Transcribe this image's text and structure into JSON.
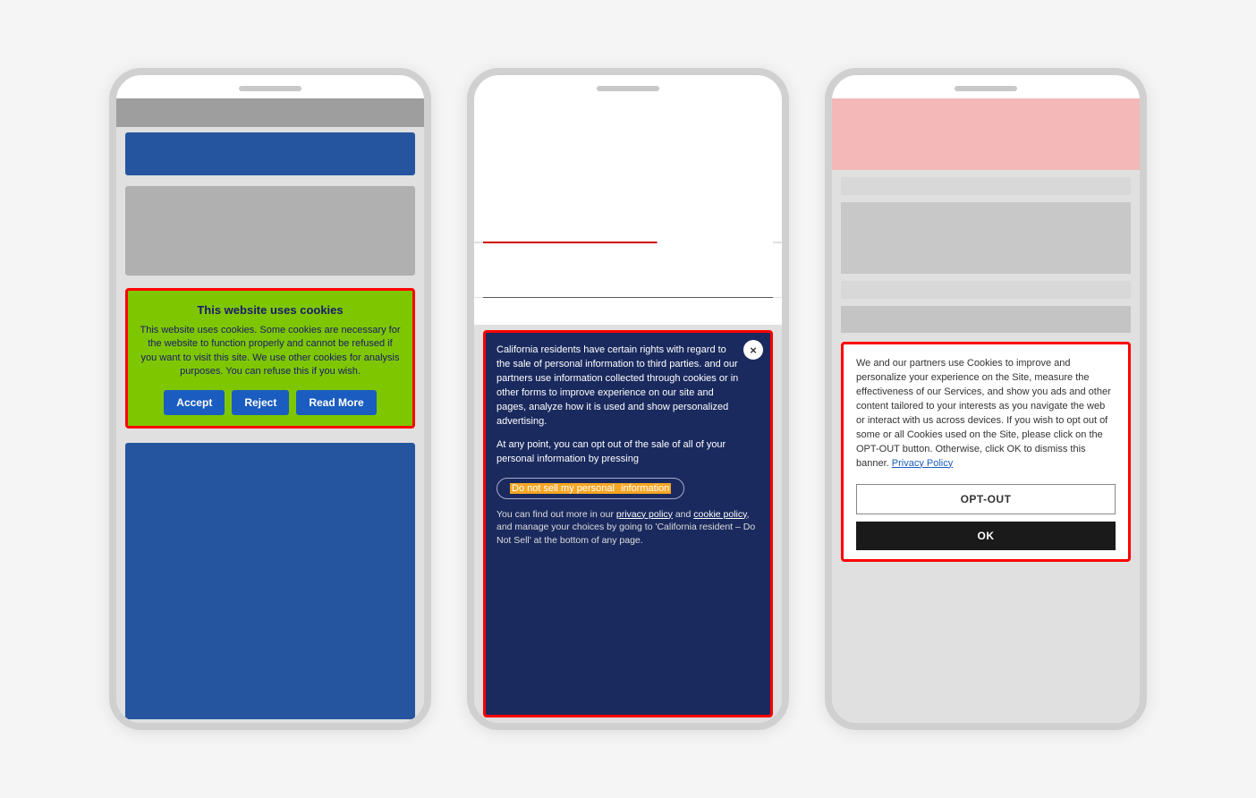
{
  "phone1": {
    "banner": {
      "title": "This website uses cookies",
      "body": "This website uses cookies. Some cookies are necessary for the website to function properly and cannot be refused if you want to visit this site. We use other cookies for analysis purposes. You can refuse this if you wish.",
      "accept_label": "Accept",
      "reject_label": "Reject",
      "read_more_label": "Read More"
    }
  },
  "phone2": {
    "banner": {
      "body1": "California residents have certain rights with regard to the sale of personal information to third parties.",
      "body2": "and our partners use information collected through cookies or in other forms to improve experience on our site and pages, analyze how it is used and show personalized advertising.",
      "opt_out_part1": "Do not sell my personal ",
      "opt_out_highlighted": "information",
      "body3": "At any point, you can opt out of the sale of all of your personal information by pressing",
      "footer": "You can find out more in our ",
      "privacy_link": "privacy policy",
      "and_text": " and ",
      "cookie_link": "cookie policy",
      "footer2": ", and manage your choices by going to 'California resident – Do Not Sell' at the bottom of any page.",
      "close_label": "×"
    }
  },
  "phone3": {
    "banner": {
      "body": "We and our partners use Cookies to improve and personalize your experience on the Site, measure the effectiveness of our Services, and show you ads and other content tailored to your interests as you navigate the web or interact with us across devices. If you wish to opt out of some or all Cookies used on the Site, please click on the OPT-OUT button. Otherwise, click OK to dismiss this banner.",
      "privacy_link": "Privacy Policy",
      "opt_out_label": "OPT-OUT",
      "ok_label": "OK"
    }
  }
}
